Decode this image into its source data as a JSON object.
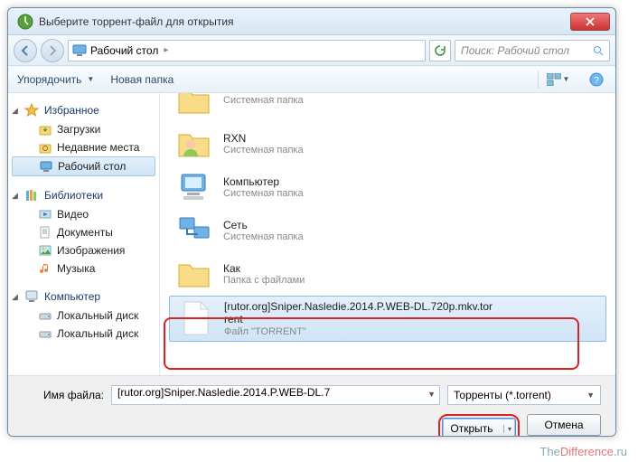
{
  "title": "Выберите торрент-файл для открытия",
  "breadcrumb": {
    "location": "Рабочий стол"
  },
  "search": {
    "placeholder": "Поиск: Рабочий стол"
  },
  "toolbar": {
    "organize": "Упорядочить",
    "newfolder": "Новая папка"
  },
  "sidebar": {
    "favorites": "Избранное",
    "fav_items": [
      "Загрузки",
      "Недавние места",
      "Рабочий стол"
    ],
    "libraries": "Библиотеки",
    "lib_items": [
      "Видео",
      "Документы",
      "Изображения",
      "Музыка"
    ],
    "computer": "Компьютер",
    "comp_items": [
      "Локальный диск",
      "Локальный диск"
    ]
  },
  "files": [
    {
      "name": "",
      "sub": "Системная папка"
    },
    {
      "name": "RXN",
      "sub": "Системная папка"
    },
    {
      "name": "Компьютер",
      "sub": "Системная папка"
    },
    {
      "name": "Сеть",
      "sub": "Системная папка"
    },
    {
      "name": "Как",
      "sub": "Папка с файлами"
    },
    {
      "name": "[rutor.org]Sniper.Nasledie.2014.P.WEB-DL.720p.mkv.torrent",
      "sub": "Файл \"TORRENT\""
    }
  ],
  "footer": {
    "filename_label": "Имя файла:",
    "filename_value": "[rutor.org]Sniper.Nasledie.2014.P.WEB-DL.7",
    "filter": "Торренты (*.torrent)",
    "open": "Открыть",
    "cancel": "Отмена"
  },
  "watermark": {
    "a": "The",
    "b": "Difference",
    "c": ".ru"
  }
}
